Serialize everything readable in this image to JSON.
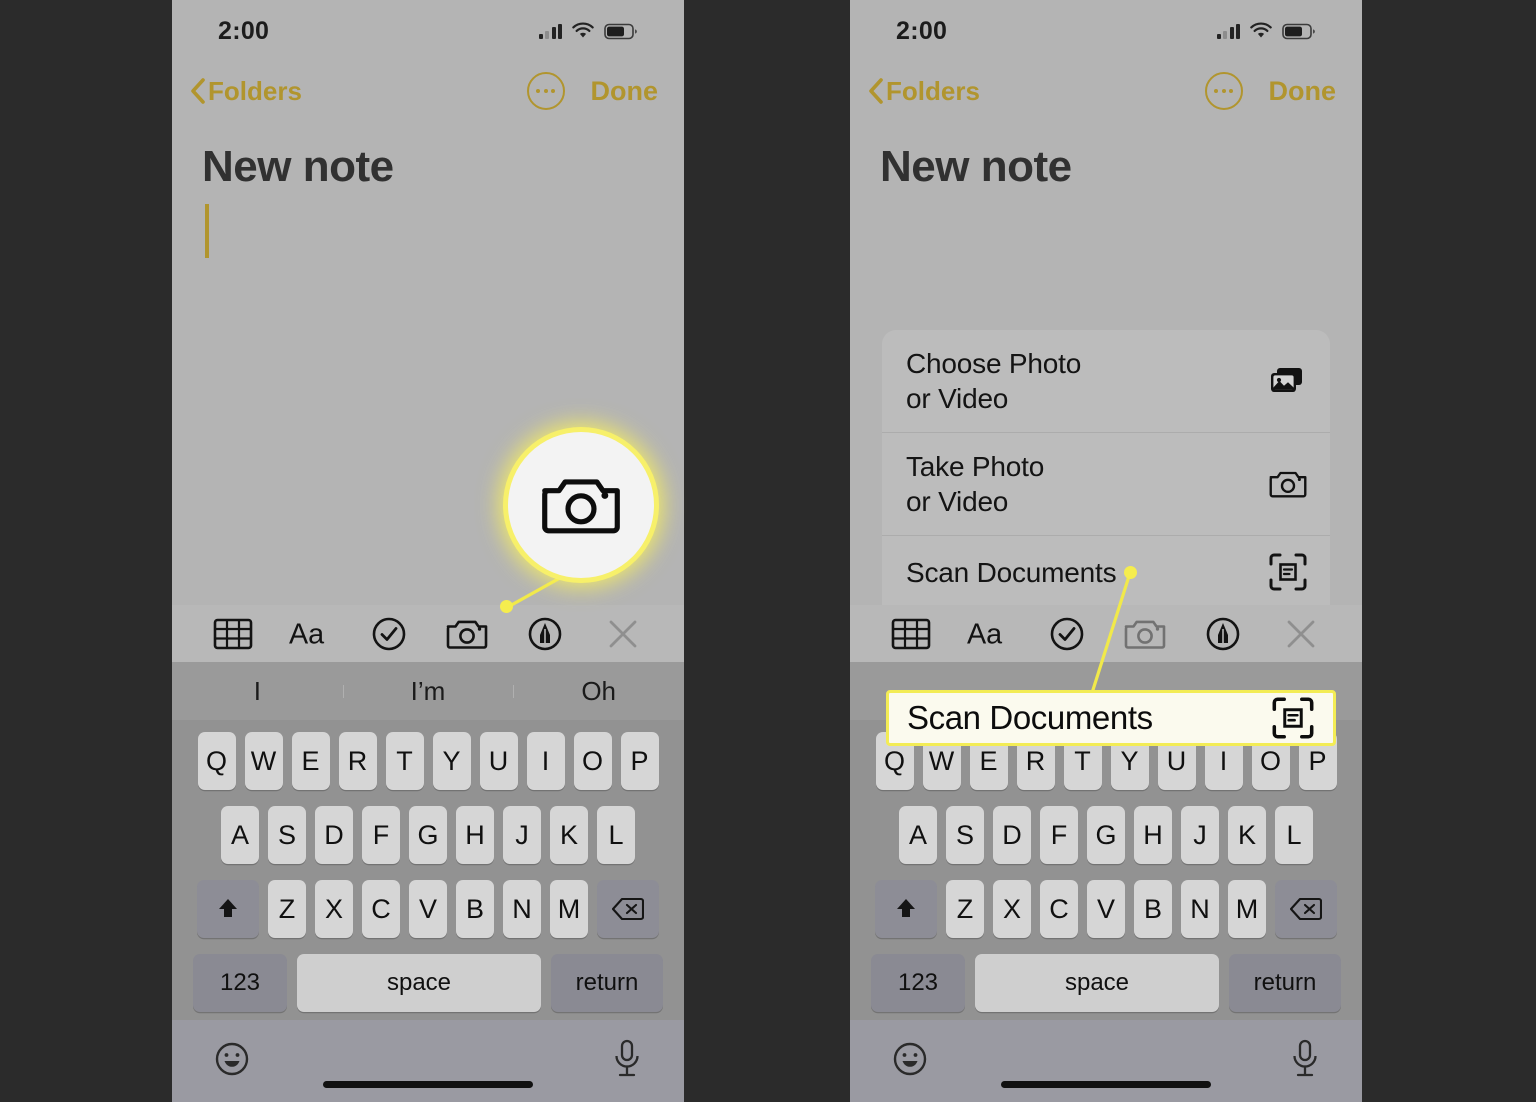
{
  "meta": {
    "accent_gold": "#b1952e",
    "highlight_yellow": "#f3ec55",
    "note_bg": "#b4b4b4",
    "keyboard_bg": "#929292"
  },
  "status_bar": {
    "time": "2:00"
  },
  "nav": {
    "back_label": "Folders",
    "more_label": "more-options",
    "done_label": "Done"
  },
  "note": {
    "title": "New note"
  },
  "format_toolbar": {
    "items": [
      {
        "name": "table-icon",
        "label": "Table"
      },
      {
        "name": "text-format-icon",
        "label": "Aa"
      },
      {
        "name": "checklist-icon",
        "label": "Checklist"
      },
      {
        "name": "camera-icon",
        "label": "Camera"
      },
      {
        "name": "markup-pen-icon",
        "label": "Markup"
      },
      {
        "name": "close-icon",
        "label": "Close"
      }
    ]
  },
  "predictive": {
    "suggestions": [
      "I",
      "I’m",
      "Oh"
    ]
  },
  "keyboard": {
    "row1": [
      "Q",
      "W",
      "E",
      "R",
      "T",
      "Y",
      "U",
      "I",
      "O",
      "P"
    ],
    "row2": [
      "A",
      "S",
      "D",
      "F",
      "G",
      "H",
      "J",
      "K",
      "L"
    ],
    "row3": [
      "Z",
      "X",
      "C",
      "V",
      "B",
      "N",
      "M"
    ],
    "shift_label": "shift",
    "backspace_label": "delete",
    "numbers_label": "123",
    "space_label": "space",
    "return_label": "return"
  },
  "bottom_bar": {
    "emoji_label": "emoji",
    "mic_label": "dictation"
  },
  "action_sheet": {
    "items": [
      {
        "label": "Choose Photo\nor Video",
        "icon": "photos-icon"
      },
      {
        "label": "Take Photo\nor Video",
        "icon": "camera-icon"
      },
      {
        "label": "Scan Documents",
        "icon": "scan-documents-icon"
      }
    ]
  },
  "callouts": {
    "left_magnifier": {
      "icon": "camera-icon",
      "target": "camera-toolbar-button"
    },
    "right_highlight": {
      "label": "Scan Documents",
      "icon": "scan-documents-icon"
    }
  }
}
